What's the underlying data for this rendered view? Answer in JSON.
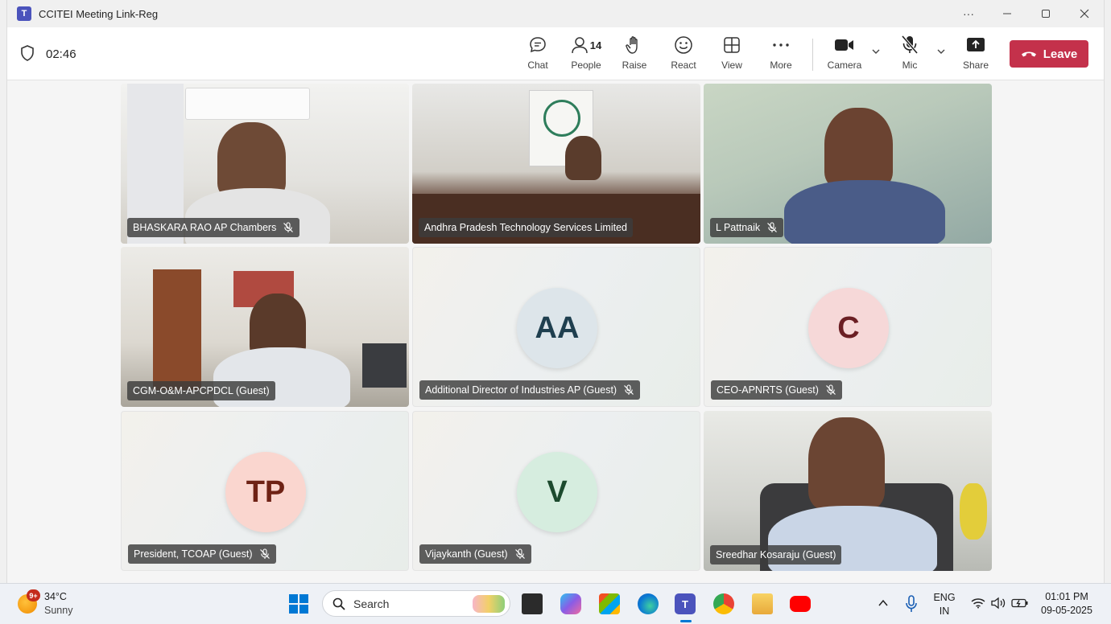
{
  "window": {
    "title": "CCITEI Meeting Link-Reg",
    "more_glyph": "···"
  },
  "toolbar": {
    "timer": "02:46",
    "chat_label": "Chat",
    "people_label": "People",
    "people_count": "14",
    "raise_label": "Raise",
    "react_label": "React",
    "view_label": "View",
    "more_label": "More",
    "camera_label": "Camera",
    "mic_label": "Mic",
    "share_label": "Share",
    "leave_label": "Leave"
  },
  "participants": [
    {
      "name": "BHASKARA RAO AP Chambers",
      "muted": true,
      "video": true
    },
    {
      "name": "Andhra Pradesh Technology Services Limited",
      "muted": false,
      "video": true
    },
    {
      "name": "L Pattnaik",
      "muted": true,
      "video": true
    },
    {
      "name": "CGM-O&M-APCPDCL (Guest)",
      "muted": false,
      "video": true
    },
    {
      "name": "Additional Director of Industries AP (Guest)",
      "muted": true,
      "video": false,
      "initials": "AA",
      "avatar_bg": "#dde5ea",
      "avatar_fg": "#1f3f4f"
    },
    {
      "name": "CEO-APNRTS (Guest)",
      "muted": true,
      "video": false,
      "initials": "C",
      "avatar_bg": "#f6d8d8",
      "avatar_fg": "#6b1f24"
    },
    {
      "name": "President, TCOAP (Guest)",
      "muted": true,
      "video": false,
      "initials": "TP",
      "avatar_bg": "#fad6cf",
      "avatar_fg": "#6e2215"
    },
    {
      "name": "Vijaykanth (Guest)",
      "muted": true,
      "video": false,
      "initials": "V",
      "avatar_bg": "#d6eddf",
      "avatar_fg": "#1c4a2e"
    },
    {
      "name": "Sreedhar Kosaraju (Guest)",
      "muted": false,
      "video": true
    }
  ],
  "taskbar": {
    "weather_badge": "9+",
    "temperature": "34°C",
    "condition": "Sunny",
    "search_label": "Search",
    "language_line1": "ENG",
    "language_line2": "IN",
    "time": "01:01 PM",
    "date": "09-05-2025"
  },
  "colors": {
    "leave_bg": "#c4314b",
    "teams_accent": "#4b53bc",
    "windows_accent": "#0078d4"
  }
}
